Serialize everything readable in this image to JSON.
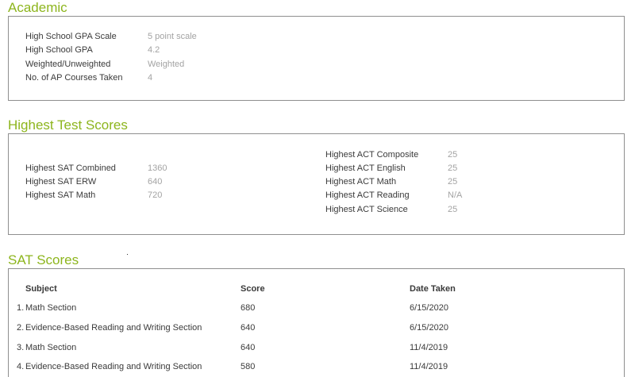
{
  "colors": {
    "accent": "#8db51d",
    "border": "#8f8f8f",
    "label_text": "#3a3a3a",
    "value_text": "#a3a3a3"
  },
  "academic": {
    "title": "Academic",
    "rows": [
      {
        "label": "High School GPA Scale",
        "value": "5 point scale"
      },
      {
        "label": "High School GPA",
        "value": "4.2"
      },
      {
        "label": "Weighted/Unweighted",
        "value": "Weighted"
      },
      {
        "label": "No. of AP Courses Taken",
        "value": "4"
      }
    ]
  },
  "test_scores": {
    "title": "Highest Test Scores",
    "sat": [
      {
        "label": "Highest SAT Combined",
        "value": "1360"
      },
      {
        "label": "Highest SAT ERW",
        "value": "640"
      },
      {
        "label": "Highest SAT Math",
        "value": "720"
      }
    ],
    "act": [
      {
        "label": "Highest ACT Composite",
        "value": "25"
      },
      {
        "label": "Highest ACT English",
        "value": "25"
      },
      {
        "label": "Highest ACT Math",
        "value": "25"
      },
      {
        "label": "Highest ACT Reading",
        "value": "N/A"
      },
      {
        "label": "Highest ACT Science",
        "value": "25"
      }
    ]
  },
  "sat_scores": {
    "title": "SAT Scores",
    "headers": {
      "subject": "Subject",
      "score": "Score",
      "date": "Date Taken"
    },
    "rows": [
      {
        "index": "1.",
        "subject": "Math Section",
        "score": "680",
        "date": "6/15/2020"
      },
      {
        "index": "2.",
        "subject": "Evidence-Based Reading and Writing Section",
        "score": "640",
        "date": "6/15/2020"
      },
      {
        "index": "3.",
        "subject": "Math Section",
        "score": "640",
        "date": "11/4/2019"
      },
      {
        "index": "4.",
        "subject": "Evidence-Based Reading and Writing Section",
        "score": "580",
        "date": "11/4/2019"
      }
    ]
  }
}
